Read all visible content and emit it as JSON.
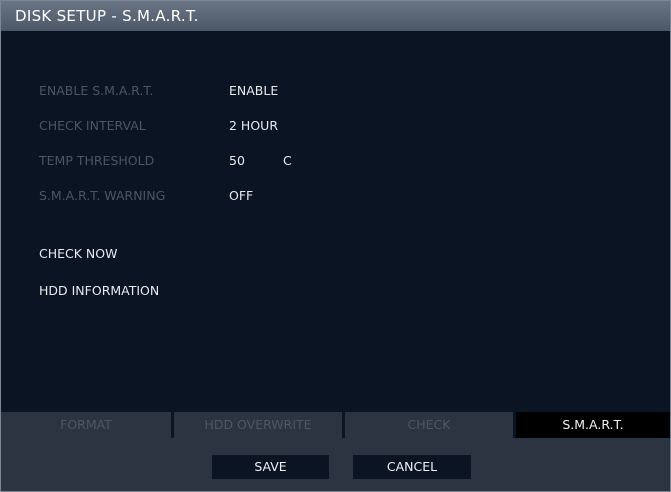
{
  "window": {
    "title": "DISK SETUP - S.M.A.R.T."
  },
  "settings": [
    {
      "label": "ENABLE S.M.A.R.T.",
      "value": "ENABLE"
    },
    {
      "label": "CHECK INTERVAL",
      "value": "2 HOUR"
    },
    {
      "label": "TEMP THRESHOLD",
      "value": "50",
      "unit": "C"
    },
    {
      "label": "S.M.A.R.T. WARNING",
      "value": "OFF"
    }
  ],
  "actions": {
    "check_now": "CHECK NOW",
    "hdd_information": "HDD INFORMATION"
  },
  "tabs": [
    {
      "label": "FORMAT",
      "active": false
    },
    {
      "label": "HDD OVERWRITE",
      "active": false
    },
    {
      "label": "CHECK",
      "active": false
    },
    {
      "label": "S.M.A.R.T.",
      "active": true
    }
  ],
  "footer": {
    "save_label": "SAVE",
    "cancel_label": "CANCEL"
  },
  "colors": {
    "background": "#0b1422",
    "titlebar": "#5a6576",
    "panel": "#2b3440",
    "text_active": "#e8eaee",
    "text_dim": "#4b5563"
  }
}
